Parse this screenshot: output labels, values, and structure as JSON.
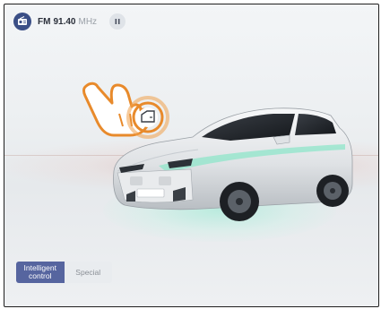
{
  "radio": {
    "band": "FM",
    "frequency": "91.40",
    "unit": "MHz",
    "source_icon": "radio-icon",
    "pause_icon": "pause-icon"
  },
  "modes": {
    "items": [
      {
        "label": "Intelligent control",
        "active": true
      },
      {
        "label": "Special",
        "active": false
      }
    ]
  },
  "hotspot": {
    "icon": "car-door-icon",
    "pointer_icon": "hand-pointer-icon"
  },
  "colors": {
    "accent": "#56659f",
    "radio_badge": "#3b4f86",
    "hotspot_orange": "#e88a2b",
    "glow": "#9cebd3"
  }
}
